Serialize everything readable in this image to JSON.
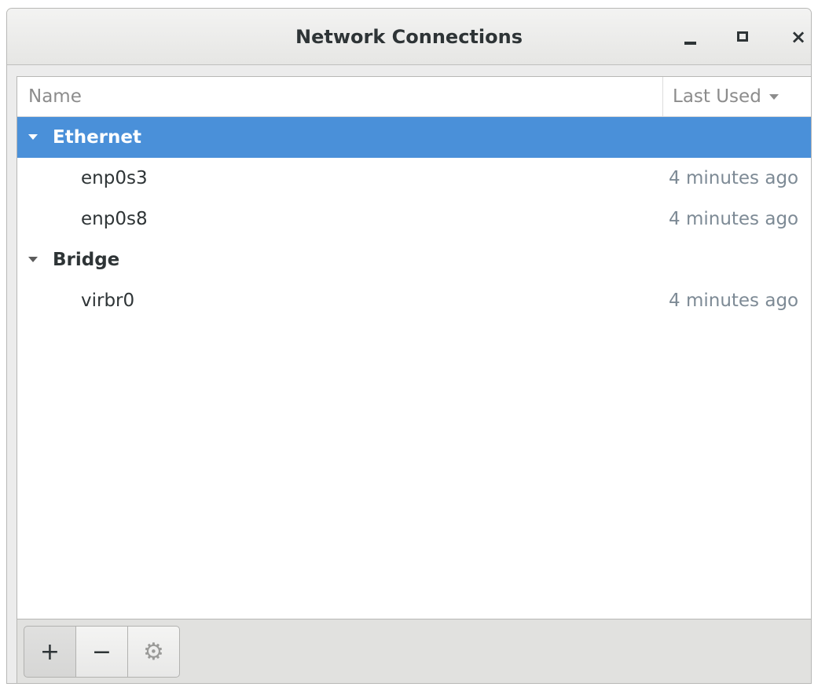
{
  "window": {
    "title": "Network Connections",
    "controls": {
      "minimize_icon": "minimize-icon",
      "maximize_icon": "maximize-icon",
      "close_icon": "close-icon",
      "close_glyph": "×"
    }
  },
  "list": {
    "columns": {
      "name": "Name",
      "last_used": "Last Used"
    },
    "sort_icon": "sort-descending-icon",
    "groups": [
      {
        "label": "Ethernet",
        "expanded": true,
        "selected": true,
        "connections": [
          {
            "name": "enp0s3",
            "last_used": "4 minutes ago"
          },
          {
            "name": "enp0s8",
            "last_used": "4 minutes ago"
          }
        ]
      },
      {
        "label": "Bridge",
        "expanded": true,
        "selected": false,
        "connections": [
          {
            "name": "virbr0",
            "last_used": "4 minutes ago"
          }
        ]
      }
    ]
  },
  "toolbar": {
    "add_label": "+",
    "remove_label": "−",
    "settings_icon": "gear-icon",
    "settings_glyph": "⚙"
  },
  "colors": {
    "selection": "#4a90d9",
    "secondary_text": "#7d8a95"
  }
}
